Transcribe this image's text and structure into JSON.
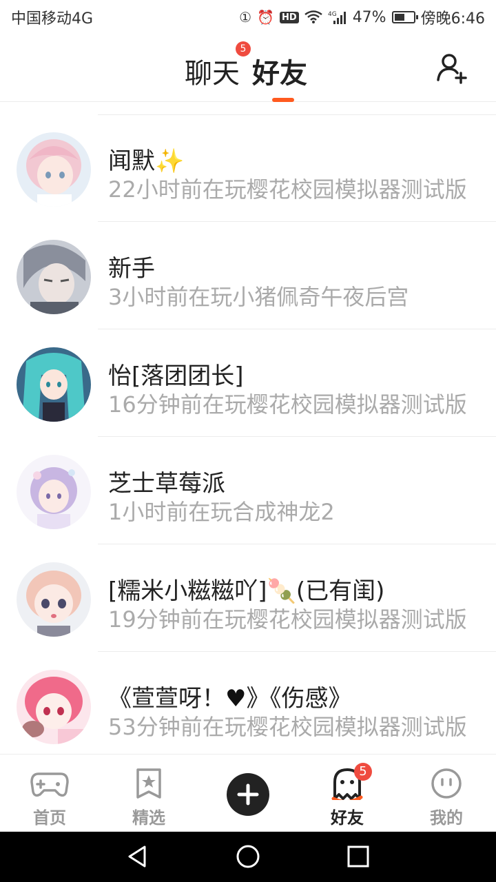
{
  "status_bar": {
    "carrier": "中国移动4G",
    "signal_label": "4G",
    "battery_pct": "47%",
    "time": "傍晚6:46",
    "hd": "HD",
    "sim": "1"
  },
  "header": {
    "tabs": [
      {
        "label": "聊天",
        "badge": "5"
      },
      {
        "label": "好友"
      }
    ],
    "active_tab": "好友",
    "accent_color": "#ff5a1f"
  },
  "friends": [
    {
      "name": "闻默",
      "suffix": "✨",
      "activity": "22小时前在玩樱花校园模拟器测试版"
    },
    {
      "name": "新手",
      "suffix": "",
      "activity": "3小时前在玩小猪佩奇午夜后宫"
    },
    {
      "name": "怡[落团团长]",
      "suffix": "",
      "activity": "16分钟前在玩樱花校园模拟器测试版"
    },
    {
      "name": "芝士草莓派",
      "suffix": "",
      "activity": "1小时前在玩合成神龙2"
    },
    {
      "name": "[糯米小糍糍吖]",
      "suffix": "🍡",
      "suffix2": "(已有闺)",
      "activity": "19分钟前在玩樱花校园模拟器测试版"
    },
    {
      "name": "《萱萱呀！",
      "suffix": "♥",
      "suffix2": "》《伤感》",
      "activity": "53分钟前在玩樱花校园模拟器测试版"
    }
  ],
  "bottom_nav": {
    "items": [
      {
        "label": "首页",
        "icon": "gamepad-icon"
      },
      {
        "label": "精选",
        "icon": "bookmark-star-icon"
      },
      {
        "label": "",
        "icon": "plus-icon"
      },
      {
        "label": "好友",
        "icon": "ghost-icon",
        "badge": "5"
      },
      {
        "label": "我的",
        "icon": "smiley-icon"
      }
    ],
    "active": "好友"
  }
}
